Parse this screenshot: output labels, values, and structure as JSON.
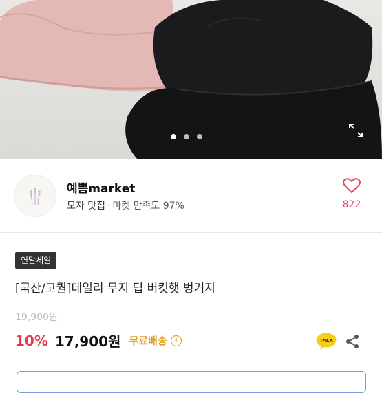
{
  "carousel": {
    "slide_count": 3,
    "active_index": 0
  },
  "seller": {
    "name": "예쁨market",
    "category": "모자 맛집",
    "separator": "·",
    "satisfaction": "마켓 만족도 97%",
    "likes": "822"
  },
  "product": {
    "badge": "연말세일",
    "title": "[국산/고퀄]데일리 무지 딥 버킷햇 벙거지",
    "original_price": "19,900원",
    "discount": "10%",
    "price": "17,900원",
    "shipping": "무료배송",
    "talk_label": "TALK"
  },
  "colors": {
    "discount": "#e23c4c",
    "shipping": "#e09a1a",
    "like": "#e24a64",
    "talk_bubble": "#f5cf17"
  },
  "icons": [
    "expand-icon",
    "heart-icon",
    "info-icon",
    "talk-icon",
    "share-icon"
  ]
}
